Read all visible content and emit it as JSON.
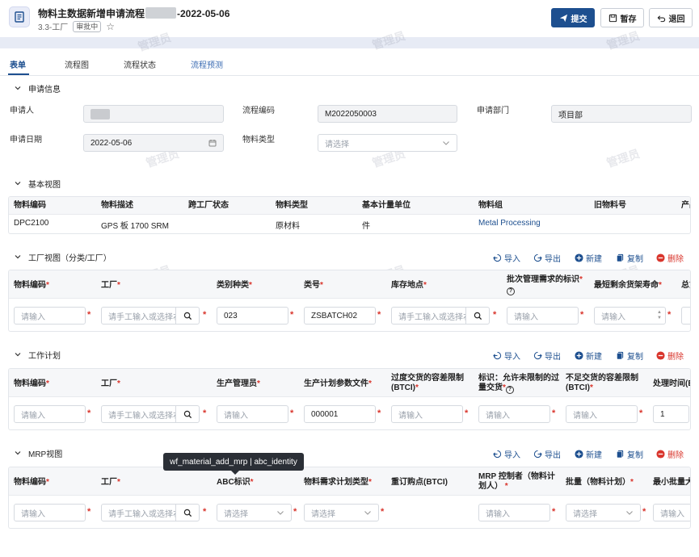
{
  "header": {
    "title_prefix": "物料主数据新增申请流程",
    "title_suffix": "-2022-05-06",
    "subtitle": "3.3-工厂",
    "badge": "审批中",
    "submit_label": "提交",
    "save_label": "暂存",
    "return_label": "退回"
  },
  "tabs": [
    {
      "label": "表单"
    },
    {
      "label": "流程图"
    },
    {
      "label": "流程状态"
    },
    {
      "label": "流程预测"
    }
  ],
  "watermark": "管理员",
  "apply_info": {
    "title": "申请信息",
    "applicant_label": "申请人",
    "process_code_label": "流程编码",
    "process_code_value": "M2022050003",
    "dept_label": "申请部门",
    "dept_value": "项目部",
    "date_label": "申请日期",
    "date_value": "2022-05-06",
    "material_type_label": "物料类型",
    "material_type_placeholder": "请选择"
  },
  "basic_view": {
    "title": "基本视图",
    "headers": [
      "物料编码",
      "物料描述",
      "跨工厂状态",
      "物料类型",
      "基本计量单位",
      "物料组",
      "旧物料号",
      "产品"
    ],
    "row": [
      "DPC2100",
      "GPS 板 1700 SRM",
      "",
      "原材料",
      "件",
      "Metal Processing",
      "",
      ""
    ]
  },
  "actions": {
    "import": "导入",
    "export": "导出",
    "new": "新建",
    "copy": "复制",
    "delete": "删除"
  },
  "plant_view": {
    "title": "工厂视图（分类/工厂）",
    "headers": [
      "物料编码",
      "工厂",
      "类别种类",
      "类号",
      "库存地点",
      "批次管理需求的标识",
      "最短剩余货架寿命",
      "总货"
    ],
    "values": {
      "material_code_ph": "请输入",
      "plant_ph": "请手工输入或选择右",
      "class_type": "023",
      "class_no": "ZSBATCH02",
      "storage_ph": "请手工输入或选择右",
      "batch_ph": "请输入",
      "shelf_ph": "请输入"
    }
  },
  "work_plan": {
    "title": "工作计划",
    "headers": [
      "物料编码",
      "工厂",
      "生产管理员",
      "生产计划参数文件",
      "过度交货的容差限制",
      "(BTCI)",
      "标识：允许未限制的过",
      "量交货",
      "不足交货的容差限制",
      "(BTCI)",
      "处理时间(BT"
    ],
    "values": {
      "material_code_ph": "请输入",
      "plant_ph": "请手工输入或选择右",
      "manager_ph": "请输入",
      "param_file": "000001",
      "over_ph": "请输入",
      "flag_ph": "请输入",
      "under_ph": "请输入",
      "proc_time": "1"
    }
  },
  "mrp_view": {
    "title": "MRP视图",
    "headers": [
      "物料编码",
      "工厂",
      "ABC标识",
      "物料需求计划类型",
      "重订购点(BTCI)",
      "MRP 控制者（物料计",
      "划人）",
      "批量（物料计划）",
      "最小批量大小"
    ],
    "values": {
      "material_code_ph": "请输入",
      "plant_ph": "请手工输入或选择右",
      "abc_ph": "请选择",
      "mrp_type_ph": "请选择",
      "controller_ph": "请输入",
      "lot_ph": "请选择",
      "min_lot_ph": "请输入"
    }
  },
  "tooltip": "wf_material_add_mrp | abc_identity",
  "colors": {
    "primary": "#1d4f8f",
    "danger": "#d9352c",
    "link": "#3b6cb3"
  }
}
